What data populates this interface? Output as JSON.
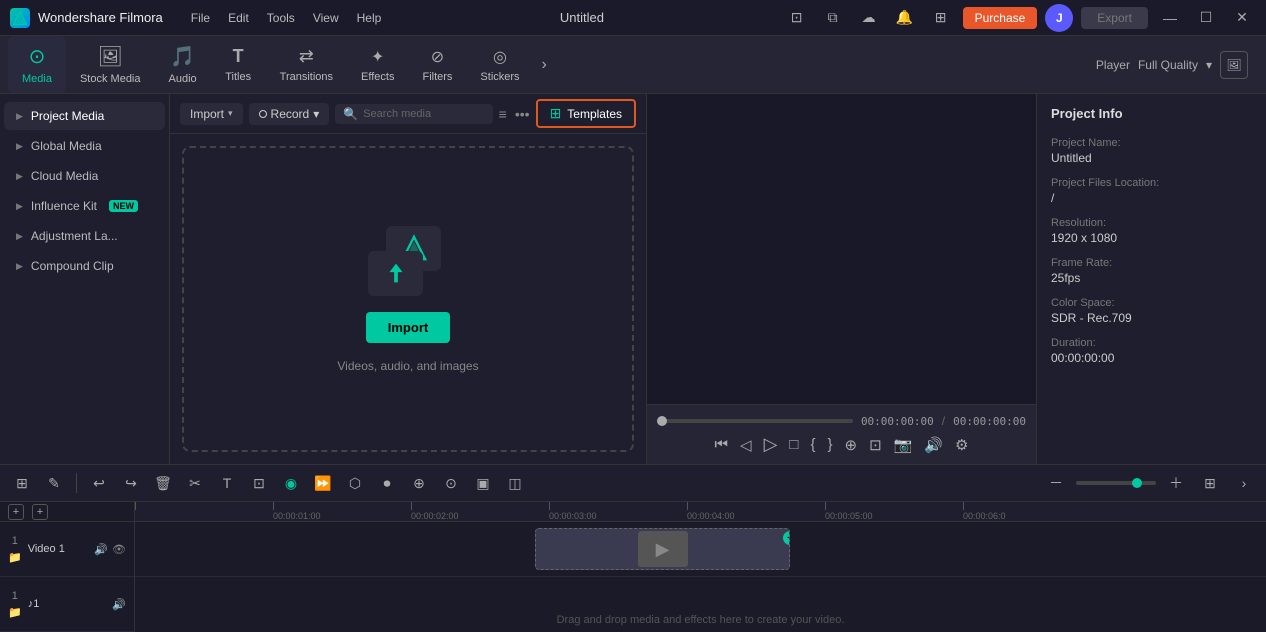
{
  "app": {
    "name": "Wondershare Filmora",
    "logo_char": "W",
    "title": "Untitled"
  },
  "menu": {
    "items": [
      "File",
      "Edit",
      "Tools",
      "View",
      "Help"
    ]
  },
  "titlebar": {
    "purchase_label": "Purchase",
    "export_label": "Export"
  },
  "toolbar": {
    "items": [
      {
        "id": "media",
        "label": "Media",
        "active": true,
        "icon": "🎬"
      },
      {
        "id": "stock-media",
        "label": "Stock Media",
        "active": false,
        "icon": "📦"
      },
      {
        "id": "audio",
        "label": "Audio",
        "active": false,
        "icon": "🎵"
      },
      {
        "id": "titles",
        "label": "Titles",
        "active": false,
        "icon": "T"
      },
      {
        "id": "transitions",
        "label": "Transitions",
        "active": false,
        "icon": "⟷"
      },
      {
        "id": "effects",
        "label": "Effects",
        "active": false,
        "icon": "✨"
      },
      {
        "id": "filters",
        "label": "Filters",
        "active": false,
        "icon": "🎨"
      },
      {
        "id": "stickers",
        "label": "Stickers",
        "active": false,
        "icon": "😊"
      }
    ],
    "more_icon": "›",
    "player_label": "Player",
    "quality_label": "Full Quality"
  },
  "media_panel": {
    "import_label": "Import",
    "record_label": "Record",
    "search_placeholder": "Search media",
    "templates_label": "Templates",
    "drop_zone": {
      "import_btn": "Import",
      "sub_text": "Videos, audio, and images"
    }
  },
  "sidebar": {
    "items": [
      {
        "id": "project-media",
        "label": "Project Media",
        "active": true
      },
      {
        "id": "global-media",
        "label": "Global Media",
        "active": false
      },
      {
        "id": "cloud-media",
        "label": "Cloud Media",
        "active": false
      },
      {
        "id": "influence-kit",
        "label": "Influence Kit",
        "active": false,
        "badge": "NEW"
      },
      {
        "id": "adjustment-la",
        "label": "Adjustment La...",
        "active": false
      },
      {
        "id": "compound-clip",
        "label": "Compound Clip",
        "active": false
      }
    ]
  },
  "player": {
    "current_time": "00:00:00:00",
    "total_time": "00:00:00:00"
  },
  "project_info": {
    "title": "Project Info",
    "name_label": "Project Name:",
    "name_value": "Untitled",
    "files_label": "Project Files Location:",
    "files_value": "/",
    "resolution_label": "Resolution:",
    "resolution_value": "1920 x 1080",
    "framerate_label": "Frame Rate:",
    "framerate_value": "25fps",
    "colorspace_label": "Color Space:",
    "colorspace_value": "SDR - Rec.709",
    "duration_label": "Duration:",
    "duration_value": "00:00:00:00"
  },
  "timeline": {
    "tracks": [
      {
        "id": "video-1",
        "name": "Video 1",
        "type": "video"
      },
      {
        "id": "audio-1",
        "name": "♪1",
        "type": "audio"
      }
    ],
    "ruler_marks": [
      {
        "pos": 0,
        "label": ""
      },
      {
        "pos": 155,
        "label": "00:00:01:00"
      },
      {
        "pos": 290,
        "label": "00:00:02:00"
      },
      {
        "pos": 425,
        "label": "00:00:03:00"
      },
      {
        "pos": 560,
        "label": "00:00:04:00"
      },
      {
        "pos": 695,
        "label": "00:00:05:00"
      },
      {
        "pos": 830,
        "label": "00:00:06:0"
      }
    ],
    "drag_drop_label": "Drag and drop media and effects here to create your video."
  }
}
